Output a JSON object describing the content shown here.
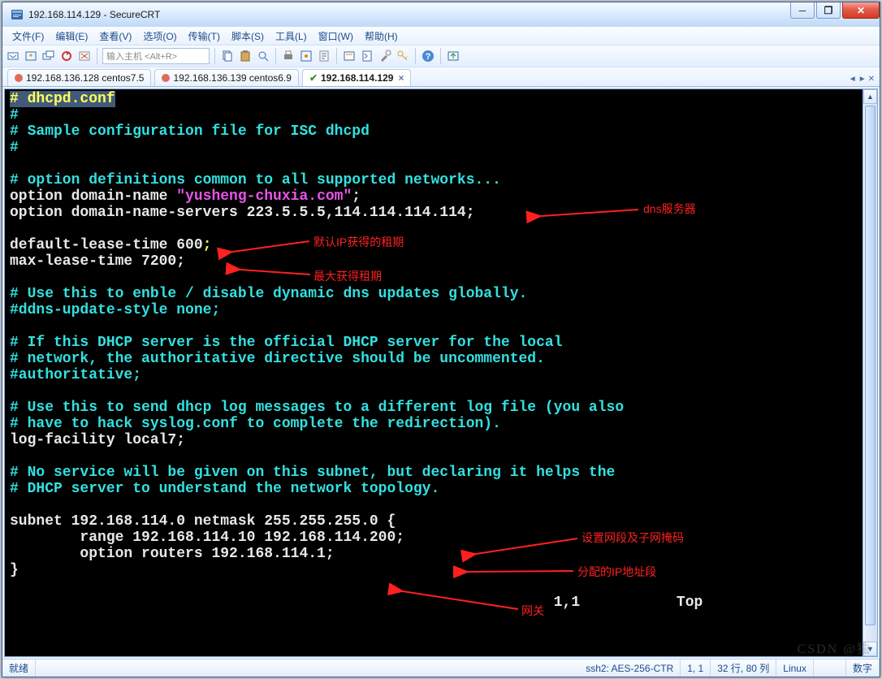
{
  "window": {
    "title": "192.168.114.129 - SecureCRT"
  },
  "menu": {
    "file": "文件(F)",
    "edit": "编辑(E)",
    "view": "查看(V)",
    "options": "选项(O)",
    "transfer": "传输(T)",
    "script": "脚本(S)",
    "tools": "工具(L)",
    "window": "窗口(W)",
    "help": "帮助(H)"
  },
  "toolbar": {
    "host_placeholder": "输入主机 <Alt+R>"
  },
  "tabs": [
    {
      "label": "192.168.136.128 centos7.5",
      "color": "#e06b5c",
      "active": false
    },
    {
      "label": "192.168.136.139 centos6.9",
      "color": "#e06b5c",
      "active": false
    },
    {
      "label": "192.168.114.129",
      "color": "#3fbf3f",
      "active": true
    }
  ],
  "terminal": {
    "lines_html": "<span class=\"c-head\"># dhcpd.conf</span>\n<span class=\"c-com\">#</span>\n<span class=\"c-com\"># Sample configuration file for ISC dhcpd</span>\n<span class=\"c-com\">#</span>\n\n<span class=\"c-com\"># option definitions common to all supported networks...</span>\n<span class=\"c-wh\">option domain-name </span><span class=\"c-mag\">\"yusheng-chuxia.com\"</span><span class=\"c-wh\">;</span>\n<span class=\"c-wh\">option domain-name-servers 223.5.5.5,114.114.114.114;</span>\n\n<span class=\"c-wh\">default-lease-time 600</span><span class=\"c-ylw\">;</span>\n<span class=\"c-wh\">max-lease-time 7200;</span>\n\n<span class=\"c-com\"># Use this to enble / disable dynamic dns updates globally.</span>\n<span class=\"c-com\">#ddns-update-style none;</span>\n\n<span class=\"c-com\"># If this DHCP server is the official DHCP server for the local</span>\n<span class=\"c-com\"># network, the authoritative directive should be uncommented.</span>\n<span class=\"c-com\">#authoritative;</span>\n\n<span class=\"c-com\"># Use this to send dhcp log messages to a different log file (you also</span>\n<span class=\"c-com\"># have to hack syslog.conf to complete the redirection).</span>\n<span class=\"c-wh\">log-facility local7;</span>\n\n<span class=\"c-com\"># No service will be given on this subnet, but declaring it helps the</span>\n<span class=\"c-com\"># DHCP server to understand the network topology.</span>\n\n<span class=\"c-wh\">subnet 192.168.114.0 netmask 255.255.255.0 {</span>\n<span class=\"c-wh\">        range 192.168.114.10 192.168.114.200;</span>\n<span class=\"c-wh\">        option routers 192.168.114.1;</span>\n<span class=\"c-wh\">}</span>\n\n<span class=\"c-wh\">                                                              1,1           Top</span>",
    "cursor": "1,1",
    "scroll": "Top"
  },
  "annotations": {
    "dns": "dns服务器",
    "default_lease": "默认IP获得的租期",
    "max_lease": "最大获得租期",
    "subnet": "设置网段及子网掩码",
    "range": "分配的IP地址段",
    "gateway": "网关"
  },
  "status": {
    "ready": "就绪",
    "cipher": "ssh2: AES-256-CTR",
    "pos": "1,  1",
    "size": "32 行, 80 列",
    "os": "Linux",
    "extra": "数字"
  },
  "watermark": "CSDN @独"
}
